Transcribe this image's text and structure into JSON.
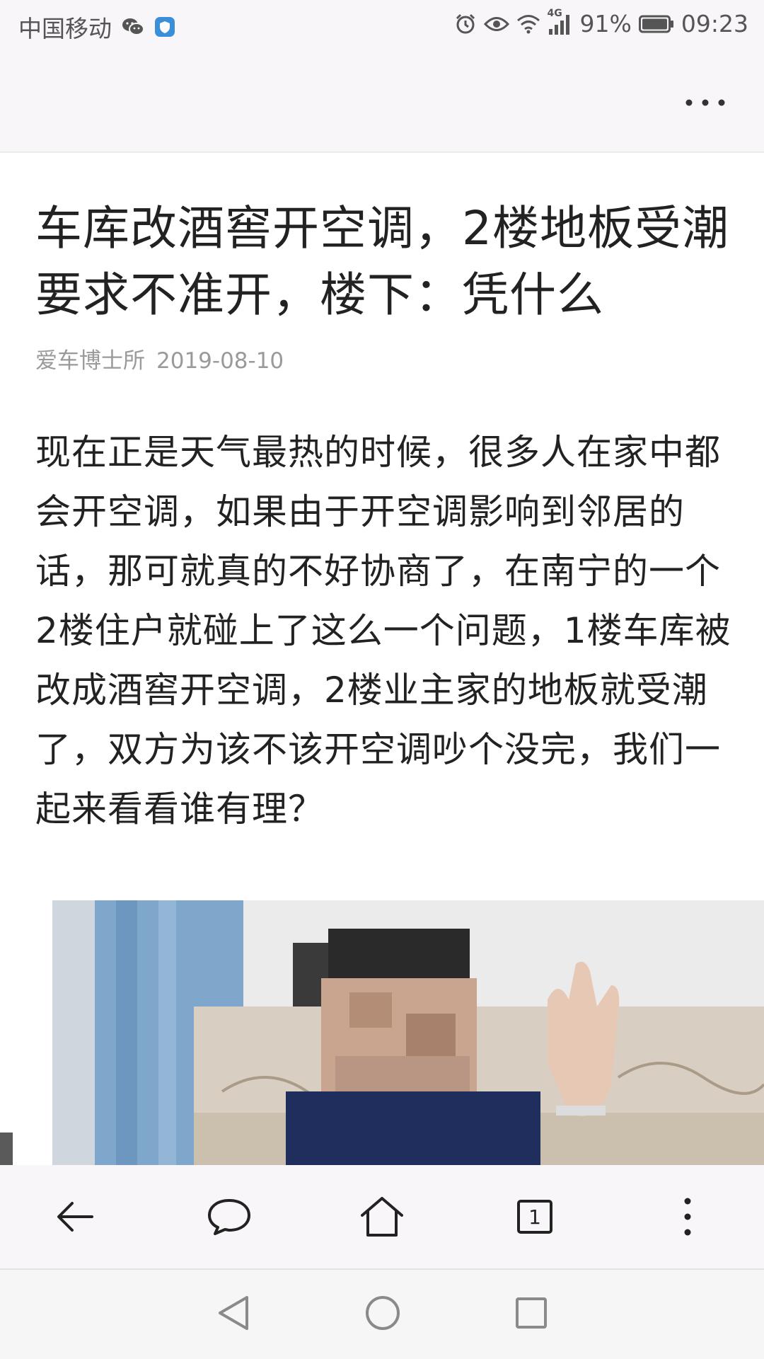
{
  "status_bar": {
    "carrier": "中国移动",
    "network": "4G",
    "battery": "91%",
    "time": "09:23",
    "icons": [
      "wechat-icon",
      "shield-icon",
      "alarm-icon",
      "eye-icon",
      "wifi-icon",
      "signal-icon",
      "battery-icon"
    ]
  },
  "article": {
    "title": "车库改酒窖开空调，2楼地板受潮要求不准开，楼下：凭什么",
    "source": "爱车博士所",
    "date": "2019-08-10",
    "body": "现在正是天气最热的时候，很多人在家中都会开空调，如果由于开空调影响到邻居的话，那可就真的不好协商了，在南宁的一个2楼住户就碰上了这么一个问题，1楼车库被改成酒窖开空调，2楼业主家的地板就受潮了，双方为该不该开空调吵个没完，我们一起来看看谁有理？"
  },
  "toolbar": {
    "tab_count": "1",
    "icons": [
      "back-arrow-icon",
      "comment-icon",
      "home-icon",
      "tabs-icon",
      "more-vertical-icon"
    ]
  },
  "system_nav": {
    "icons": [
      "back-triangle-icon",
      "home-circle-icon",
      "recents-square-icon"
    ]
  }
}
